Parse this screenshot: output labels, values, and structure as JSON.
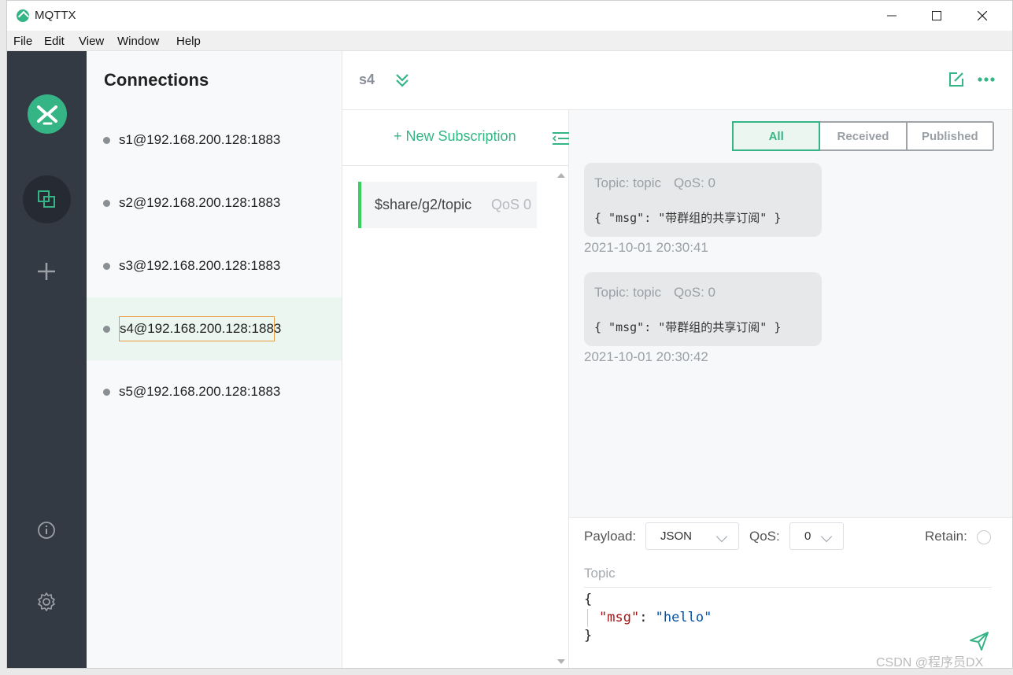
{
  "window": {
    "title": "MQTTX"
  },
  "menu": [
    "File",
    "Edit",
    "View",
    "Window",
    "Help"
  ],
  "connections_panel": {
    "title": "Connections",
    "items": [
      {
        "label": "s1@192.168.200.128:1883"
      },
      {
        "label": "s2@192.168.200.128:1883"
      },
      {
        "label": "s3@192.168.200.128:1883"
      },
      {
        "label": "s4@192.168.200.128:1883"
      },
      {
        "label": "s5@192.168.200.128:1883"
      }
    ]
  },
  "header": {
    "connection_name": "s4"
  },
  "subscriptions": {
    "new_label": "+ New Subscription",
    "items": [
      {
        "topic": "$share/g2/topic",
        "qos": "QoS 0"
      }
    ]
  },
  "filters": {
    "all": "All",
    "received": "Received",
    "published": "Published",
    "active": "All"
  },
  "messages": [
    {
      "topic": "Topic: topic",
      "qos": "QoS: 0",
      "payload": "{ \"msg\": \"带群组的共享订阅\" }",
      "time": "2021-10-01 20:30:41"
    },
    {
      "topic": "Topic: topic",
      "qos": "QoS: 0",
      "payload": "{ \"msg\": \"带群组的共享订阅\" }",
      "time": "2021-10-01 20:30:42"
    }
  ],
  "publish": {
    "payload_label": "Payload:",
    "payload_format": "JSON",
    "qos_label": "QoS:",
    "qos_value": "0",
    "retain_label": "Retain:",
    "topic_placeholder": "Topic",
    "payload_lines": {
      "open": "{",
      "key": "\"msg\"",
      "sep": ": ",
      "value": "\"hello\"",
      "close": "}"
    }
  },
  "watermark": "CSDN @程序员DX",
  "colors": {
    "accent": "#35b585",
    "sidebar": "#333a44",
    "active_item": "#eaf6ef"
  }
}
